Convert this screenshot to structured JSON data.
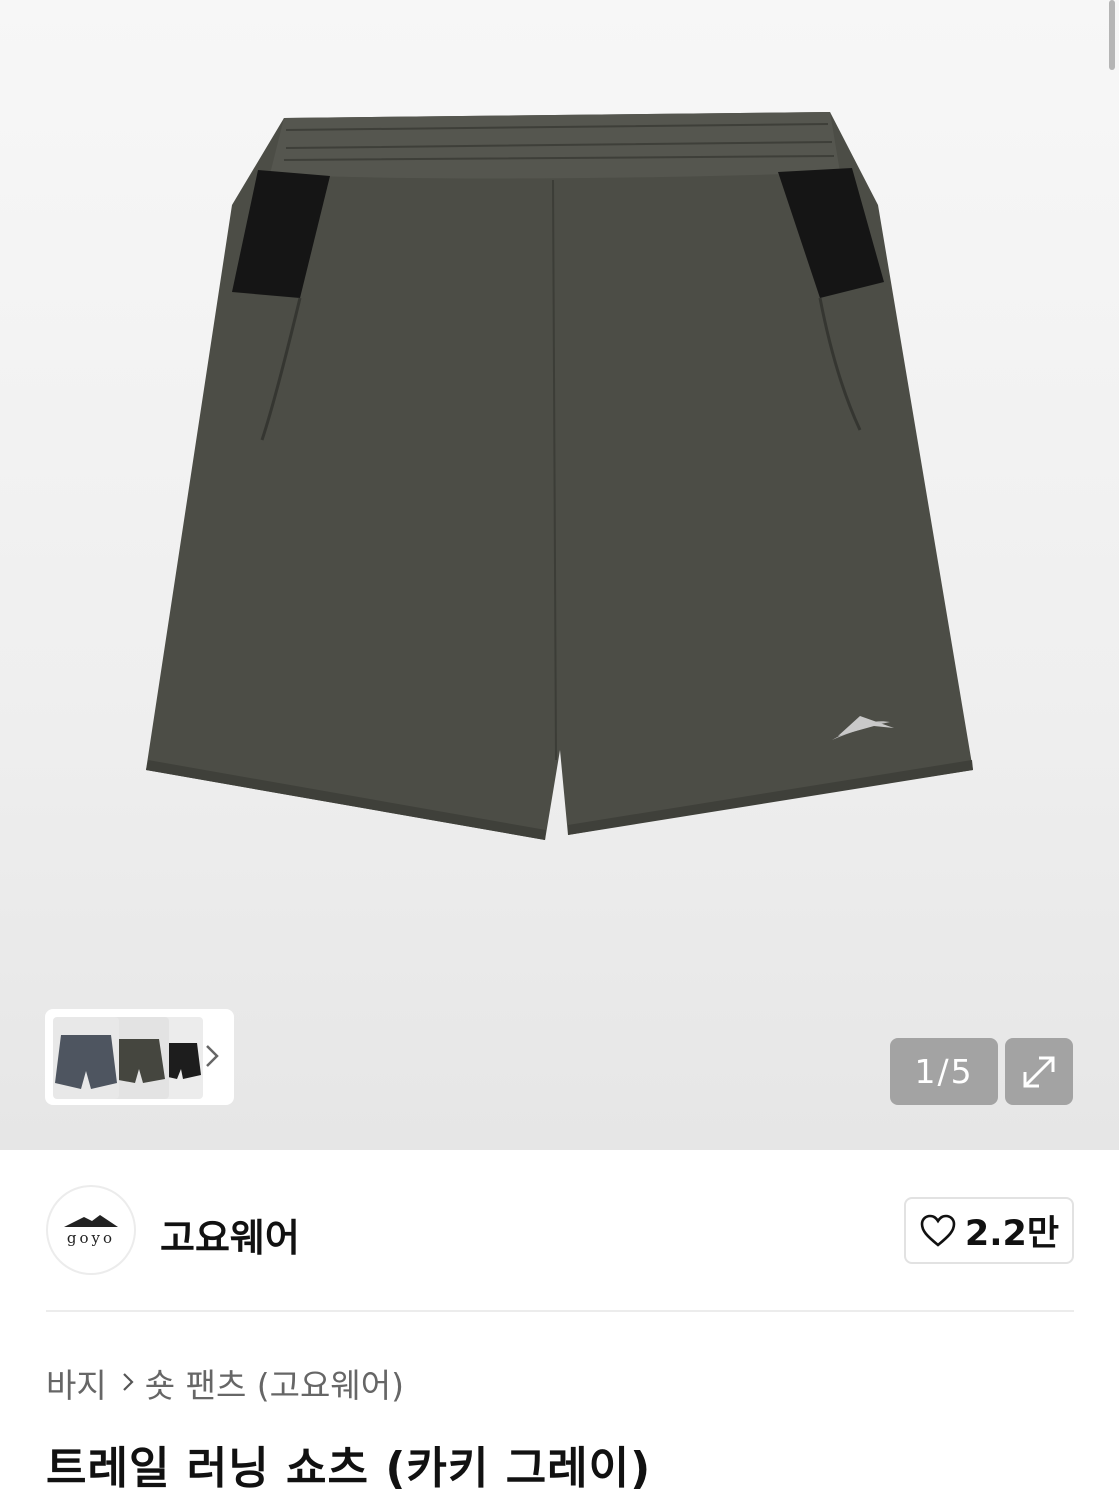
{
  "gallery": {
    "current_page": "1",
    "total_pages": "5",
    "page_separator": "/",
    "thumbnail_count": 3
  },
  "brand": {
    "logo_text": "goyo",
    "name": "고요웨어",
    "like_count": "2.2만"
  },
  "breadcrumb": {
    "items": [
      "바지",
      "숏 팬츠 (고요웨어)"
    ]
  },
  "product": {
    "title": "트레일 러닝 쇼츠 (카키 그레이)"
  },
  "icons": {
    "thumbnail_next": "chevron-right-icon",
    "expand": "expand-arrow-icon",
    "like": "heart-icon",
    "breadcrumb_separator": "chevron-right-icon"
  },
  "colors": {
    "shorts_body": "#4c4d46",
    "shorts_panel": "#151515",
    "hero_background": "#efefef"
  }
}
